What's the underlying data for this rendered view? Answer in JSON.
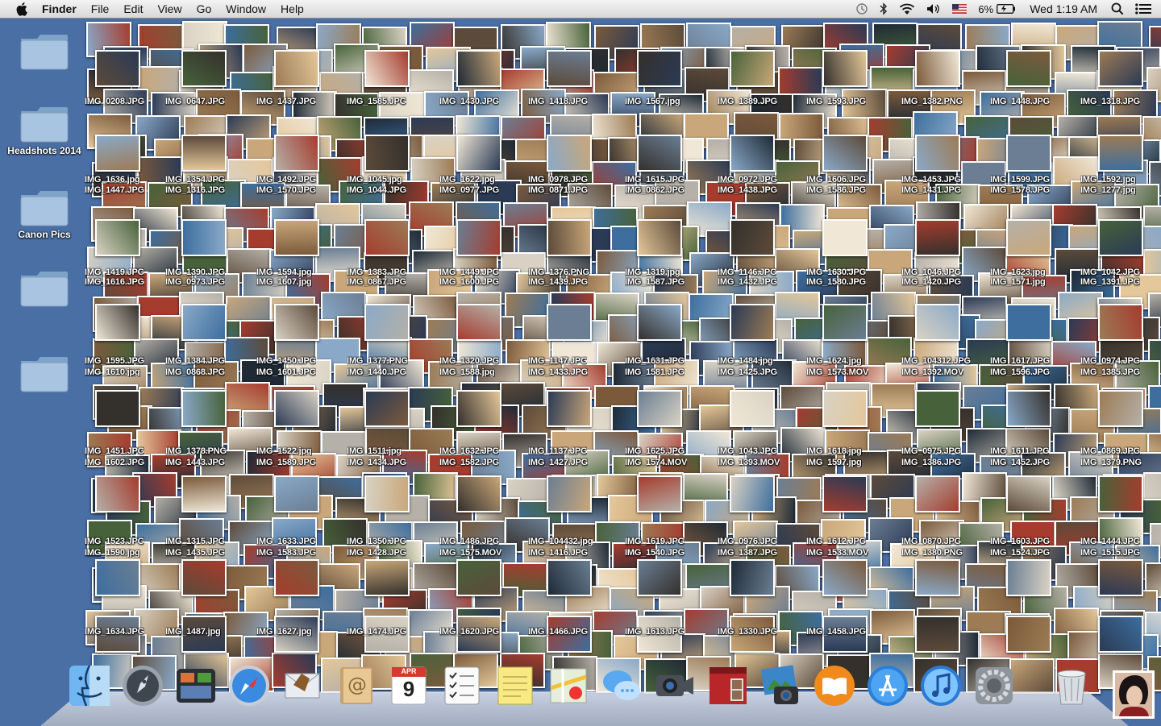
{
  "menubar": {
    "app_name": "Finder",
    "menus": [
      "File",
      "Edit",
      "View",
      "Go",
      "Window",
      "Help"
    ],
    "battery_percent": "6%",
    "clock": "Wed 1:19 AM"
  },
  "desktop": {
    "folders": [
      {
        "label": ""
      },
      {
        "label": "Headshots 2014"
      },
      {
        "label": "Canon Pics"
      },
      {
        "label": ""
      },
      {
        "label": ""
      }
    ],
    "file_labels": [
      "IMG_0208.JPG",
      "IMG_0647.JPG",
      "IMG_1437.JPG",
      "IMG_1585.JPG",
      "IMG_1430.JPG",
      "IMG_1418.JPG",
      "IMG_1567.jpg",
      "IMG_1389.JPG",
      "IMG_1593.JPG",
      "IMG_1382.PNG",
      "IMG_1448.JPG",
      "IMG_1318.JPG",
      "IMG_1636.jpg",
      "IMG_1354.JPG",
      "IMG_1492.JPG",
      "IMG_1045.jpg",
      "IMG_1622.jpg",
      "IMG_0978.JPG",
      "IMG_1615.JPG",
      "IMG_0972.JPG",
      "IMG_1606.JPG",
      "IMG_1453.JPG",
      "IMG_1599.JPG",
      "IMG_1592.jpg",
      "IMG_1447.JPG",
      "IMG_1316.JPG",
      "IMG_1570.JPG",
      "IMG_1044.JPG",
      "IMG_0977.JPG",
      "IMG_0871.JPG",
      "IMG_0862.JPG",
      "IMG_1438.JPG",
      "IMG_1586.JPG",
      "IMG_1431.JPG",
      "IMG_1578.JPG",
      "IMG_1277.jpg",
      "IMG_1419.JPG",
      "IMG_1390.JPG",
      "IMG_1594.jpg",
      "IMG_1383.JPG",
      "IMG_1449.JPG",
      "IMG_1376.PNG",
      "IMG_1319.jpg",
      "IMG_1146.JPG",
      "IMG_1630.JPG",
      "IMG_1046.JPG",
      "IMG_1623.jpg",
      "IMG_1042.JPG",
      "IMG_1616.JPG",
      "IMG_0973.JPG",
      "IMG_1607.jpg",
      "IMG_0867.JPG",
      "IMG_1600.JPG",
      "IMG_1439.JPG",
      "IMG_1587.JPG",
      "IMG_1432.JPG",
      "IMG_1580.JPG",
      "IMG_1420.JPG",
      "IMG_1571.jpg",
      "IMG_1391.JPG",
      "IMG_1595.JPG",
      "IMG_1384.JPG",
      "IMG_1450.JPG",
      "IMG_1377.PNG",
      "IMG_1320.JPG",
      "IMG_1147.JPG",
      "IMG_1631.JPG",
      "IMG_1484.jpg",
      "IMG_1624.jpg",
      "IMG_104312.JPG",
      "IMG_1617.JPG",
      "IMG_0974.JPG",
      "IMG_1610.jpg",
      "IMG_0868.JPG",
      "IMG_1601.JPG",
      "IMG_1440.JPG",
      "IMG_1588.jpg",
      "IMG_1433.JPG",
      "IMG_1581.JPG",
      "IMG_1425.JPG",
      "IMG_1573.MOV",
      "IMG_1392.MOV",
      "IMG_1596.JPG",
      "IMG_1385.JPG",
      "IMG_1451.JPG",
      "IMG_1378.PNG",
      "IMG_1522.jpg",
      "IMG_1511.jpg",
      "IMG_1632.JPG",
      "IMG_1137.JPG",
      "IMG_1625.JPG",
      "IMG_1043.JPG",
      "IMG_1618.jpg",
      "IMG_0975.JPG",
      "IMG_1611.JPG",
      "IMG_0869.JPG",
      "IMG_1602.JPG",
      "IMG_1443.JPG",
      "IMG_1589.JPG",
      "IMG_1434.JPG",
      "IMG_1582.JPG",
      "IMG_1427.JPG",
      "IMG_1574.MOV",
      "IMG_1393.MOV",
      "IMG_1597.jpg",
      "IMG_1386.JPG",
      "IMG_1452.JPG",
      "IMG_1379.PNG",
      "IMG_1523.JPG",
      "IMG_1315.JPG",
      "IMG_1633.JPG",
      "IMG_1350.JPG",
      "IMG_1486.JPG",
      "IMG_104432.jpg",
      "IMG_1619.JPG",
      "IMG_0976.JPG",
      "IMG_1612.JPG",
      "IMG_0870.JPG",
      "IMG_1603.JPG",
      "IMG_1444.JPG",
      "IMG_1590.jpg",
      "IMG_1435.JPG",
      "IMG_1583.JPG",
      "IMG_1428.JPG",
      "IMG_1575.MOV",
      "IMG_1416.JPG",
      "IMG_1540.JPG",
      "IMG_1387.JPG",
      "IMG_1533.MOV",
      "IMG_1380.PNG",
      "IMG_1524.JPG",
      "IMG_1515.JPG",
      "IMG_1634.JPG",
      "IMG_1487.jpg",
      "IMG_1627.jpg",
      "IMG_1474.JPG",
      "IMG_1620.JPG",
      "IMG_1466.JPG",
      "IMG_1613.JPG",
      "IMG_1330.JPG",
      "IMG_1458.JPG"
    ]
  },
  "dock": {
    "calendar_month": "APR",
    "calendar_day": "9",
    "items": [
      {
        "name": "finder-icon"
      },
      {
        "name": "launchpad-icon"
      },
      {
        "name": "mission-control-icon"
      },
      {
        "name": "safari-icon"
      },
      {
        "name": "mail-icon"
      },
      {
        "name": "contacts-icon"
      },
      {
        "name": "calendar-icon"
      },
      {
        "name": "reminders-icon"
      },
      {
        "name": "notes-icon"
      },
      {
        "name": "maps-icon"
      },
      {
        "name": "messages-icon"
      },
      {
        "name": "facetime-icon"
      },
      {
        "name": "photo-booth-icon"
      },
      {
        "name": "iphoto-icon"
      },
      {
        "name": "ibooks-icon"
      },
      {
        "name": "app-store-icon"
      },
      {
        "name": "itunes-icon"
      },
      {
        "name": "system-preferences-icon"
      },
      {
        "name": "trash-icon"
      }
    ]
  },
  "colors": {
    "desktop": "#4a6fa5",
    "folder": "#a9c4e0"
  }
}
